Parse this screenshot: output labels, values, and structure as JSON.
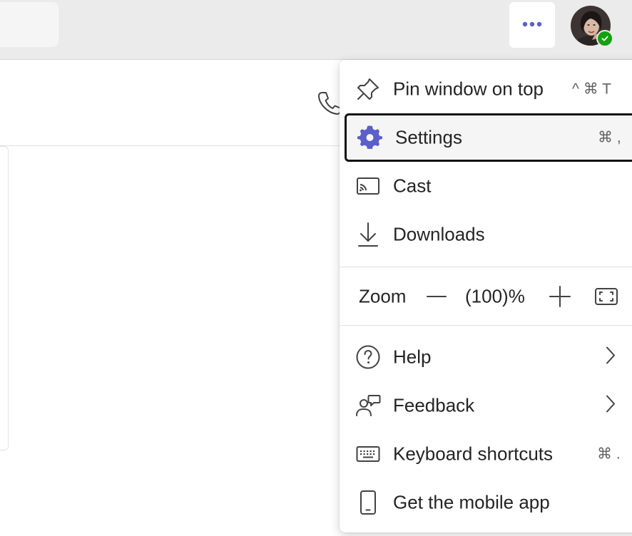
{
  "topbar": {
    "more_icon": "more-horizontal-icon",
    "avatar": "user-avatar",
    "presence_status": "available",
    "accent_color": "#5b5fc7",
    "presence_color": "#13a10e"
  },
  "chat_header": {
    "call_icon": "phone-icon"
  },
  "menu": {
    "items": [
      {
        "label": "Pin window on top",
        "shortcut": "^ ⌘ T",
        "icon": "pin-icon"
      },
      {
        "label": "Settings",
        "shortcut": "⌘ ,",
        "icon": "gear-icon"
      },
      {
        "label": "Cast",
        "shortcut": "",
        "icon": "cast-icon"
      },
      {
        "label": "Downloads",
        "shortcut": "",
        "icon": "download-icon"
      }
    ],
    "zoom": {
      "label": "Zoom",
      "value": "(100)%",
      "decrease_icon": "minus-icon",
      "increase_icon": "plus-icon",
      "fullscreen_icon": "fullscreen-icon"
    },
    "lower_items": [
      {
        "label": "Help",
        "icon": "help-icon",
        "submenu": true
      },
      {
        "label": "Feedback",
        "icon": "feedback-icon",
        "submenu": true
      },
      {
        "label": "Keyboard shortcuts",
        "shortcut": "⌘ .",
        "icon": "keyboard-icon"
      },
      {
        "label": "Get the mobile app",
        "icon": "mobile-icon"
      }
    ]
  }
}
